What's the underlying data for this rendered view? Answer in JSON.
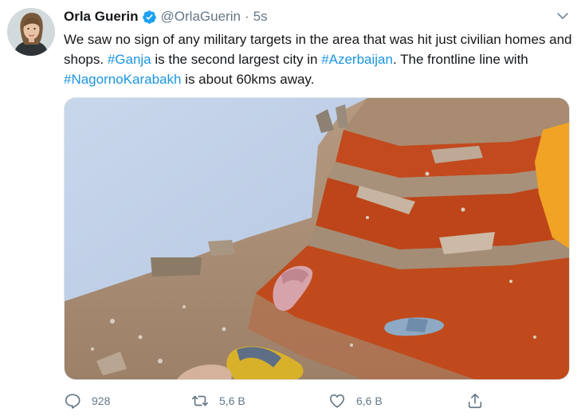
{
  "author": {
    "name": "Orla Guerin",
    "handle": "@OrlaGuerin",
    "separator": "·",
    "time": "5s",
    "verified": true
  },
  "tweet": {
    "parts": [
      {
        "text": "We saw no sign of any military targets in the area that was hit just civilian homes and shops. ",
        "type": "text"
      },
      {
        "text": "#Ganja",
        "type": "hashtag"
      },
      {
        "text": " is the second largest city in ",
        "type": "text"
      },
      {
        "text": "#Azerbaijan",
        "type": "hashtag"
      },
      {
        "text": ". The frontline line with ",
        "type": "text"
      },
      {
        "text": "#NagornoKarabakh",
        "type": "hashtag"
      },
      {
        "text": " is about 60kms away.",
        "type": "text"
      }
    ]
  },
  "actions": {
    "replies": "928",
    "retweets": "5,6 B",
    "likes": "6,6 B"
  },
  "colors": {
    "link": "#1b95e0",
    "secondary_text": "#657786",
    "verified_badge": "#1da1f2",
    "carpet": "#c24a1e"
  },
  "icons": {
    "verified": "verified-badge-icon",
    "menu": "chevron-down-icon",
    "reply": "reply-icon",
    "retweet": "retweet-icon",
    "like": "heart-icon",
    "share": "share-icon"
  }
}
